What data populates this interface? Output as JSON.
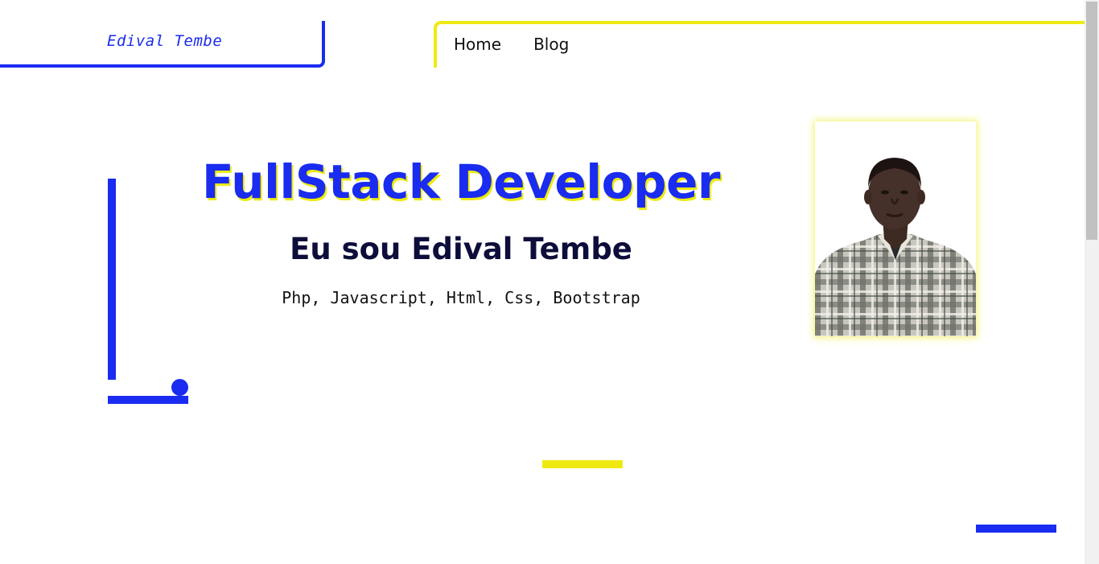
{
  "header": {
    "brand": "Edival Tembe",
    "nav": [
      {
        "label": "Home"
      },
      {
        "label": "Blog"
      }
    ]
  },
  "hero": {
    "title": "FullStack Developer",
    "subtitle": "Eu sou Edival Tembe",
    "skills": "Php, Javascript, Html, Css, Bootstrap"
  },
  "profile_photo": {
    "icon": "profile-photo"
  },
  "colors": {
    "primary_blue": "#1a2cf0",
    "accent_yellow": "#eeea10",
    "heading_dark": "#0d0d3b"
  }
}
